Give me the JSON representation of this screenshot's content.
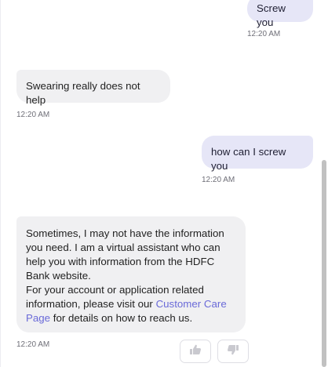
{
  "messages": [
    {
      "role": "user",
      "text": "Screw you",
      "time": "12:20 AM"
    },
    {
      "role": "bot",
      "text": "Swearing really does not help",
      "time": "12:20 AM"
    },
    {
      "role": "user",
      "text": "how can I screw you",
      "time": "12:20 AM"
    },
    {
      "role": "bot",
      "text_part1": "Sometimes, I may not have the information you need. I am a virtual assistant who can help you with information from the HDFC Bank website.",
      "text_part2": "For your account or application related information, please visit our ",
      "link_text": "Customer Care Page",
      "text_part3": " for details on how to reach us.",
      "time": "12:20 AM"
    }
  ],
  "feedback": {
    "thumbs_up_icon": "thumbs-up-icon",
    "thumbs_down_icon": "thumbs-down-icon"
  },
  "colors": {
    "user_bubble": "#e6e6f7",
    "bot_bubble": "#f0f0f2",
    "link": "#6a6ad8"
  }
}
